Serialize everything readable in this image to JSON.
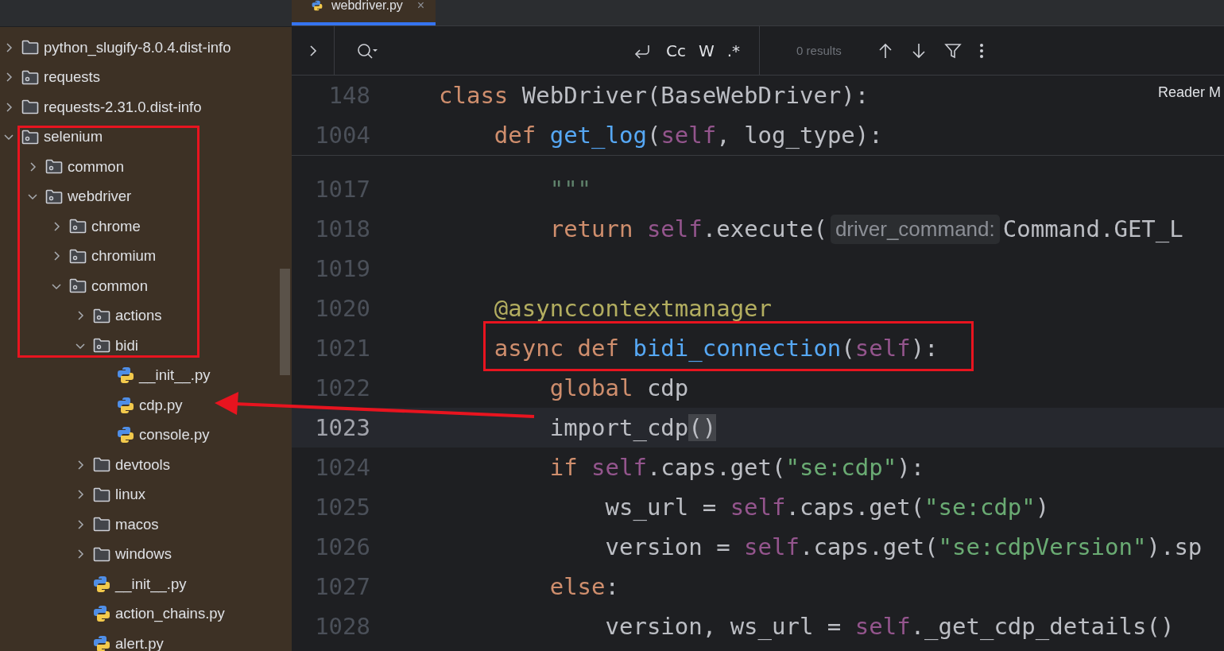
{
  "project_tree": [
    {
      "label": "python_slugify-8.0.4.dist-info",
      "kind": "folder",
      "expanded": false
    },
    {
      "label": "requests",
      "kind": "package",
      "expanded": false
    },
    {
      "label": "requests-2.31.0.dist-info",
      "kind": "folder",
      "expanded": false
    },
    {
      "label": "selenium",
      "kind": "package",
      "expanded": true,
      "children": [
        {
          "label": "common",
          "kind": "package",
          "expanded": false
        },
        {
          "label": "webdriver",
          "kind": "package",
          "expanded": true,
          "children": [
            {
              "label": "chrome",
              "kind": "package",
              "expanded": false
            },
            {
              "label": "chromium",
              "kind": "package",
              "expanded": false
            },
            {
              "label": "common",
              "kind": "package",
              "expanded": true,
              "children": [
                {
                  "label": "actions",
                  "kind": "package",
                  "expanded": false
                },
                {
                  "label": "bidi",
                  "kind": "package",
                  "expanded": true,
                  "children": [
                    {
                      "label": "__init__.py",
                      "kind": "python"
                    },
                    {
                      "label": "cdp.py",
                      "kind": "python"
                    },
                    {
                      "label": "console.py",
                      "kind": "python"
                    }
                  ]
                },
                {
                  "label": "devtools",
                  "kind": "folder",
                  "expanded": false
                },
                {
                  "label": "linux",
                  "kind": "folder",
                  "expanded": false
                },
                {
                  "label": "macos",
                  "kind": "folder",
                  "expanded": false
                },
                {
                  "label": "windows",
                  "kind": "folder",
                  "expanded": false
                },
                {
                  "label": "__init__.py",
                  "kind": "python"
                },
                {
                  "label": "action_chains.py",
                  "kind": "python"
                },
                {
                  "label": "alert.py",
                  "kind": "python"
                }
              ]
            }
          ]
        }
      ]
    }
  ],
  "editor_tab": {
    "label": "webdriver.py",
    "close": "×",
    "selected": true
  },
  "search_bar": {
    "options": [
      "Cc",
      "W",
      ".*"
    ],
    "results": "0 results"
  },
  "reader_mode": "Reader M",
  "sticky_lines": [
    {
      "number": "148",
      "current": false,
      "tokens": [
        {
          "kind": "keyword",
          "text": "class "
        },
        {
          "kind": "plain",
          "text": "WebDriver(BaseWebDriver):"
        }
      ]
    },
    {
      "number": "1004",
      "current": false,
      "tokens": [
        {
          "kind": "keyword",
          "text": "    def "
        },
        {
          "kind": "function",
          "text": "get_log"
        },
        {
          "kind": "plain",
          "text": "("
        },
        {
          "kind": "self",
          "text": "self"
        },
        {
          "kind": "plain",
          "text": ", log_type):"
        }
      ]
    }
  ],
  "code_lines": [
    {
      "number": "1017",
      "current": false,
      "tokens": [
        {
          "kind": "doc",
          "text": "        \"\"\""
        }
      ]
    },
    {
      "number": "1018",
      "current": false,
      "tokens": [
        {
          "kind": "keyword",
          "text": "        return "
        },
        {
          "kind": "self",
          "text": "self"
        },
        {
          "kind": "plain",
          "text": ".execute("
        },
        {
          "kind": "hint",
          "text": "driver_command:"
        },
        {
          "kind": "plain",
          "text": "Command.GET_L"
        }
      ]
    },
    {
      "number": "1019",
      "current": false
    },
    {
      "number": "1020",
      "current": false,
      "tokens": [
        {
          "kind": "decorator",
          "text": "    @asynccontextmanager"
        }
      ]
    },
    {
      "number": "1021",
      "current": false,
      "tokens": [
        {
          "kind": "keyword",
          "text": "    async def "
        },
        {
          "kind": "function",
          "text": "bidi_connection"
        },
        {
          "kind": "plain",
          "text": "("
        },
        {
          "kind": "self",
          "text": "self"
        },
        {
          "kind": "plain",
          "text": "):"
        }
      ]
    },
    {
      "number": "1022",
      "current": false,
      "tokens": [
        {
          "kind": "keyword",
          "text": "        global "
        },
        {
          "kind": "plain",
          "text": "cdp"
        }
      ]
    },
    {
      "number": "1023",
      "current": true,
      "tokens": [
        {
          "kind": "plain",
          "text": "        import_cdp"
        },
        {
          "kind": "match",
          "text": "()"
        }
      ]
    },
    {
      "number": "1024",
      "current": false,
      "tokens": [
        {
          "kind": "keyword",
          "text": "        if "
        },
        {
          "kind": "self",
          "text": "self"
        },
        {
          "kind": "plain",
          "text": ".caps.get("
        },
        {
          "kind": "string",
          "text": "\"se:cdp\""
        },
        {
          "kind": "plain",
          "text": "):"
        }
      ]
    },
    {
      "number": "1025",
      "current": false,
      "tokens": [
        {
          "kind": "plain",
          "text": "            ws_url = "
        },
        {
          "kind": "self",
          "text": "self"
        },
        {
          "kind": "plain",
          "text": ".caps.get("
        },
        {
          "kind": "string",
          "text": "\"se:cdp\""
        },
        {
          "kind": "plain",
          "text": ")"
        }
      ]
    },
    {
      "number": "1026",
      "current": false,
      "tokens": [
        {
          "kind": "plain",
          "text": "            version = "
        },
        {
          "kind": "self",
          "text": "self"
        },
        {
          "kind": "plain",
          "text": ".caps.get("
        },
        {
          "kind": "string",
          "text": "\"se:cdpVersion\""
        },
        {
          "kind": "plain",
          "text": ").sp"
        }
      ]
    },
    {
      "number": "1027",
      "current": false,
      "tokens": [
        {
          "kind": "keyword",
          "text": "        else"
        },
        {
          "kind": "plain",
          "text": ":"
        }
      ]
    },
    {
      "number": "1028",
      "current": false,
      "tokens": [
        {
          "kind": "plain",
          "text": "            version, ws_url = "
        },
        {
          "kind": "self",
          "text": "self"
        },
        {
          "kind": "plain",
          "text": "._get_cdp_details()"
        }
      ]
    }
  ]
}
